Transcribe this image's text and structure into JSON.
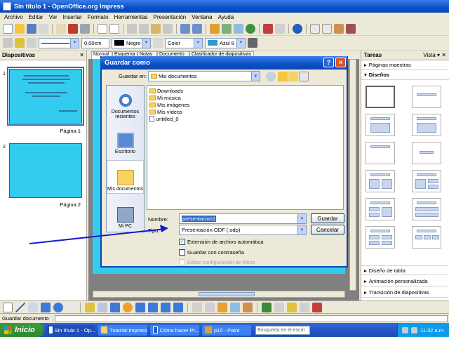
{
  "window": {
    "title": "Sin título 1 - OpenOffice.org Impress"
  },
  "menu": [
    "Archivo",
    "Editar",
    "Ver",
    "Insertar",
    "Formato",
    "Herramientas",
    "Presentación",
    "Ventana",
    "Ayuda"
  ],
  "toolbar2": {
    "line_width": "0,00cm",
    "color_name": "Negro",
    "fill_type": "Color",
    "fill_color": "Azul 8"
  },
  "slides_panel": {
    "title": "Diapositivas",
    "slides": [
      {
        "number": "1",
        "label": "Página 1"
      },
      {
        "number": "2",
        "label": "Página 2"
      }
    ]
  },
  "main_tabs": [
    "Normal",
    "Esquema",
    "Notas",
    "Documento",
    "Clasificador de diapositivas"
  ],
  "tasks": {
    "title": "Tareas",
    "view_label": "Vista",
    "sections_top": [
      "Páginas maestras",
      "Diseños"
    ],
    "sections_bottom": [
      "Diseño de tabla",
      "Animación personalizada",
      "Transición de diapositivas"
    ]
  },
  "dialog": {
    "title": "Guardar como",
    "save_in_label": "Guardar en:",
    "save_in_value": "Mis documentos",
    "places": [
      "Documentos recientes",
      "Escritorio",
      "Mis documentos",
      "Mi PC"
    ],
    "files": [
      {
        "name": "Downloads",
        "kind": "folder"
      },
      {
        "name": "Mi música",
        "kind": "folder"
      },
      {
        "name": "Mis imágenes",
        "kind": "folder"
      },
      {
        "name": "Mis vídeos",
        "kind": "folder"
      },
      {
        "name": "untitled_0",
        "kind": "doc"
      }
    ],
    "name_label": "Nombre:",
    "name_value": "presentacion1",
    "type_label": "Tipo:",
    "type_value": "Presentación ODF (.odp)",
    "save_button": "Guardar",
    "cancel_button": "Cancelar",
    "check_auto_ext": "Extensión de archivo automática",
    "check_password": "Guardar con contraseña",
    "check_filter": "Editar configuración de filtros",
    "help_glyph": "?",
    "close_glyph": "✕"
  },
  "status": {
    "text": "Guardar documento"
  },
  "taskbar": {
    "start": "Inicio",
    "buttons": [
      "Sin título 1 - Op...",
      "Tutorial-Impress",
      "Cómo hacer Pr...",
      "p10 - Paint"
    ],
    "search_placeholder": "Búsqueda en el escrit",
    "clock": "11:32 a.m."
  },
  "colors": {
    "accent": "#0b51c7",
    "slide_fill": "#33ccee",
    "arrow": "#1a1acc"
  }
}
